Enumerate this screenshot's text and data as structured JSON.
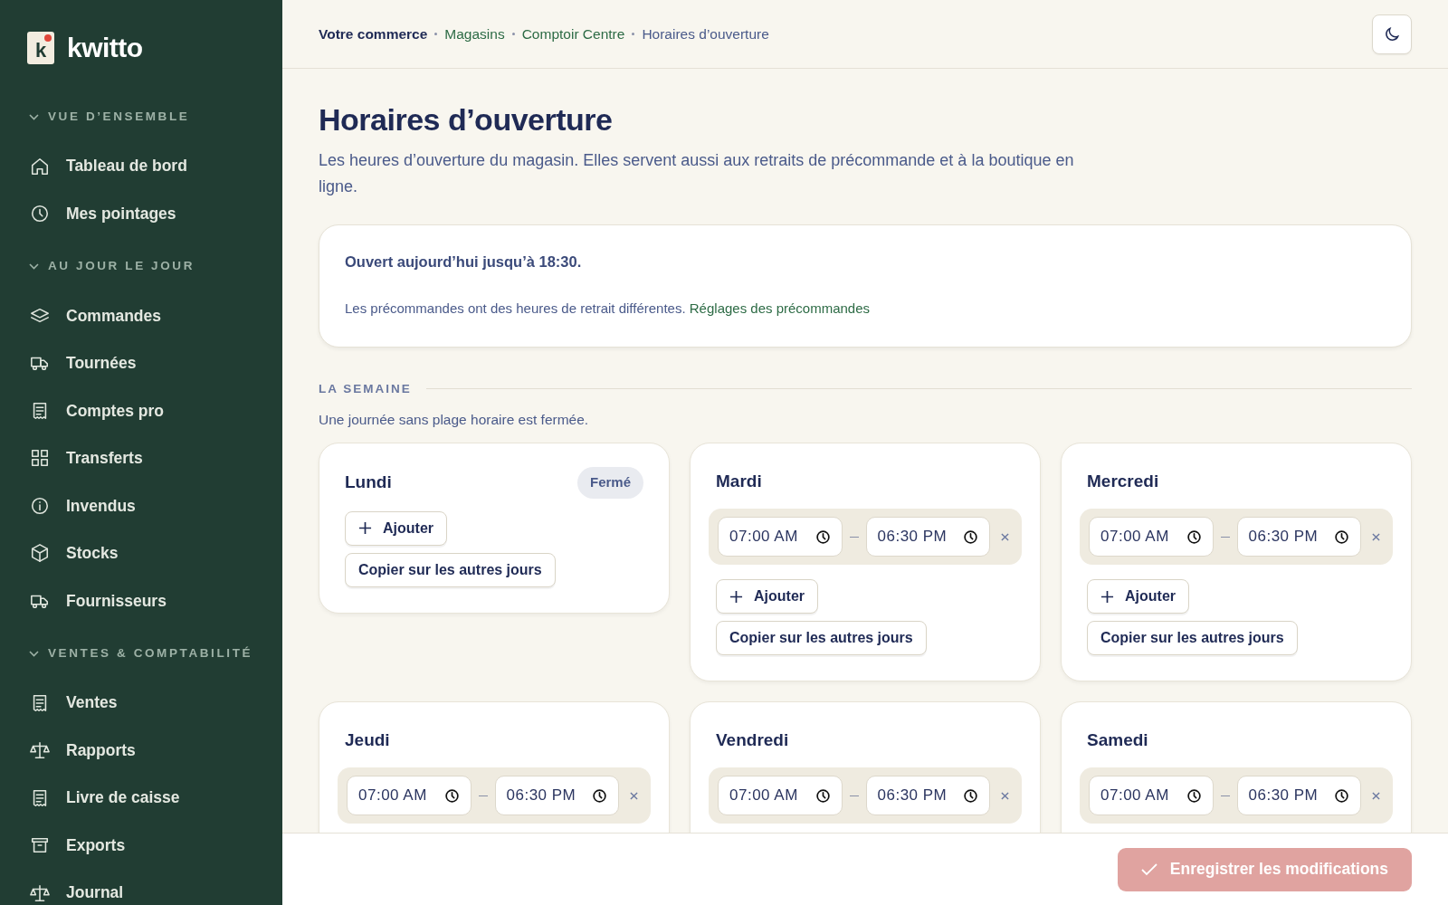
{
  "brand": {
    "mark": "k",
    "name": "kwitto"
  },
  "sidebar": {
    "sections": [
      {
        "title": "VUE D’ENSEMBLE",
        "items": [
          {
            "label": "Tableau de bord"
          },
          {
            "label": "Mes pointages"
          }
        ]
      },
      {
        "title": "AU JOUR LE JOUR",
        "items": [
          {
            "label": "Commandes"
          },
          {
            "label": "Tournées"
          },
          {
            "label": "Comptes pro"
          },
          {
            "label": "Transferts"
          },
          {
            "label": "Invendus"
          },
          {
            "label": "Stocks"
          },
          {
            "label": "Fournisseurs"
          }
        ]
      },
      {
        "title": "VENTES & COMPTABILITÉ",
        "items": [
          {
            "label": "Ventes"
          },
          {
            "label": "Rapports"
          },
          {
            "label": "Livre de caisse"
          },
          {
            "label": "Exports"
          },
          {
            "label": "Journal"
          }
        ]
      }
    ]
  },
  "breadcrumb": [
    {
      "label": "Votre commerce",
      "kind": "root"
    },
    {
      "label": "Magasins",
      "kind": "link"
    },
    {
      "label": "Comptoir Centre",
      "kind": "link"
    },
    {
      "label": "Horaires d’ouverture",
      "kind": "current"
    }
  ],
  "page": {
    "title": "Horaires d’ouverture",
    "description": "Les heures d’ouverture du magasin. Elles servent aussi aux retraits de précommande et à la boutique en ligne."
  },
  "status_card": {
    "headline": "Ouvert aujourd’hui jusqu’à 18:30.",
    "note": "Les précommandes ont des heures de retrait différentes.",
    "link": "Réglages des précommandes"
  },
  "week": {
    "heading": "LA SEMAINE",
    "hint": "Une journée sans plage horaire est fermée.",
    "days": [
      {
        "name": "Lundi",
        "badge": "Fermé",
        "add_button": "Ajouter",
        "copy_button": "Copier sur les autres jours"
      },
      {
        "name": "Mardi",
        "slots": [
          {
            "start": "07:00 AM",
            "end": "06:30 PM"
          }
        ],
        "add_button": "Ajouter",
        "copy_button": "Copier sur les autres jours"
      },
      {
        "name": "Mercredi",
        "slots": [
          {
            "start": "07:00 AM",
            "end": "06:30 PM"
          }
        ],
        "add_button": "Ajouter",
        "copy_button": "Copier sur les autres jours"
      },
      {
        "name": "Jeudi",
        "slots": [
          {
            "start": "07:00 AM",
            "end": "06:30 PM"
          }
        ]
      },
      {
        "name": "Vendredi",
        "slots": [
          {
            "start": "07:00 AM",
            "end": "06:30 PM"
          }
        ]
      },
      {
        "name": "Samedi",
        "slots": [
          {
            "start": "07:00 AM",
            "end": "06:30 PM"
          }
        ]
      }
    ]
  },
  "save_button": {
    "label": "Enregistrer les modifications",
    "disabled": true
  }
}
